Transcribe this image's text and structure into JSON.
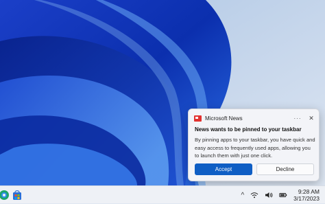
{
  "notification": {
    "app_name": "Microsoft News",
    "title": "News wants to be pinned to your taskbar",
    "body": "By pinning apps to your taskbar, you have quick and easy access to frequently used apps, allowing you to launch them with just one click.",
    "more_label": "···",
    "close_label": "✕",
    "accept_label": "Accept",
    "decline_label": "Decline",
    "accent_color": "#0f5ec4",
    "app_icon": "news-icon"
  },
  "taskbar": {
    "chevron": "^",
    "time": "9:28 AM",
    "date": "3/17/2023",
    "icons": [
      "edge-icon",
      "store-icon",
      "wifi-icon",
      "volume-icon",
      "battery-icon"
    ]
  }
}
